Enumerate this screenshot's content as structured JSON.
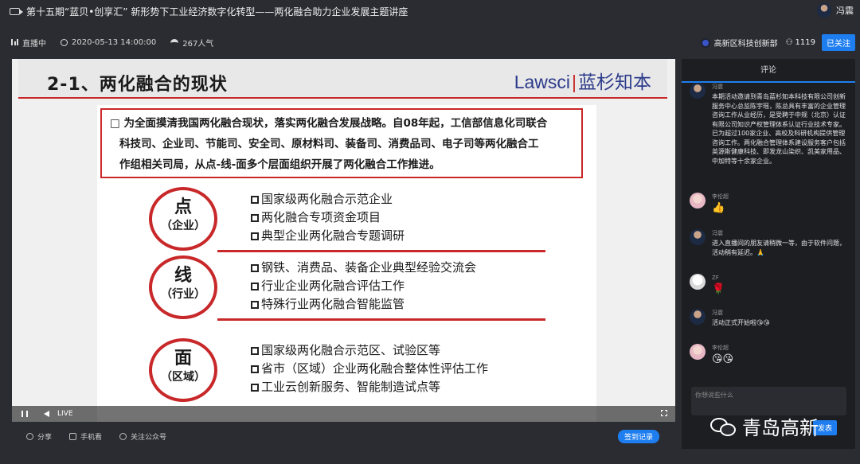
{
  "header": {
    "title": "第十五期“蓝贝•创享汇” 新形势下工业经济数字化转型——两化融合助力企业发展主题讲座",
    "username": "冯震"
  },
  "status": {
    "live": "直播中",
    "datetime": "2020-05-13 14:00:00",
    "popularity": "267人气",
    "organizer": "高新区科技创新部",
    "followers": "1119",
    "follow_label": "已关注"
  },
  "slide": {
    "title": "2-1、两化融合的现状",
    "logo_left": "Lawsci",
    "logo_sep": "|",
    "logo_right": "蓝杉知本",
    "intro_lines": [
      "□ 为全面摸清我国两化融合现状，落实两化融合发展战略。自08年起，工信部信息化司联合",
      "科技司、企业司、节能司、安全司、原材料司、装备司、消费品司、电子司等两化融合工",
      "作组相关司局，从点-线-面多个层面组织开展了两化融合工作推进。"
    ],
    "sections": [
      {
        "big": "点",
        "small": "（企业）",
        "items": [
          "国家级两化融合示范企业",
          "两化融合专项资金项目",
          "典型企业两化融合专题调研"
        ]
      },
      {
        "big": "线",
        "small": "（行业）",
        "items": [
          "钢铁、消费品、装备企业典型经验交流会",
          "行业企业两化融合评估工作",
          "特殊行业两化融合智能监管"
        ]
      },
      {
        "big": "面",
        "small": "（区域）",
        "items": [
          "国家级两化融合示范区、试验区等",
          "省市（区域）企业两化融合整体性评估工作",
          "工业云创新服务、智能制造试点等"
        ]
      }
    ]
  },
  "player": {
    "live_label": "LIVE"
  },
  "bottom": {
    "share": "分享",
    "mobile": "手机看",
    "follow_public": "关注公众号",
    "checkin": "签到记录"
  },
  "comments_panel": {
    "title": "评论",
    "comments": [
      {
        "name": "冯震",
        "text": "本期活动邀请到青岛蓝杉知本科技有限公司创新服务中心总监陈宇瑶，陈总具有丰富的企业管理咨询工作从业经历，是受聘于中规（北京）认证有限公司知识产权管理体系认证行业技术专家。已为超过100家企业、高校及科研机构提供管理咨询工作。两化融合管理体系建设服务客户包括英源斯健康科技、即发龙山染织、凯美家用品、中加特等十余家企业。"
      },
      {
        "name": "李伦超",
        "text": "👍"
      },
      {
        "name": "冯震",
        "text": "进入直播间的朋友请稍微一等，由于软件问题，活动稍有延迟。🙏"
      },
      {
        "name": "ZF",
        "text": "🌹"
      },
      {
        "name": "冯震",
        "text": "活动正式开始啦😘😘"
      },
      {
        "name": "李伦超",
        "text": "😘😘"
      }
    ],
    "input_placeholder": "你想说些什么",
    "send_label": "发表"
  },
  "watermark": {
    "text": "青岛高新"
  }
}
